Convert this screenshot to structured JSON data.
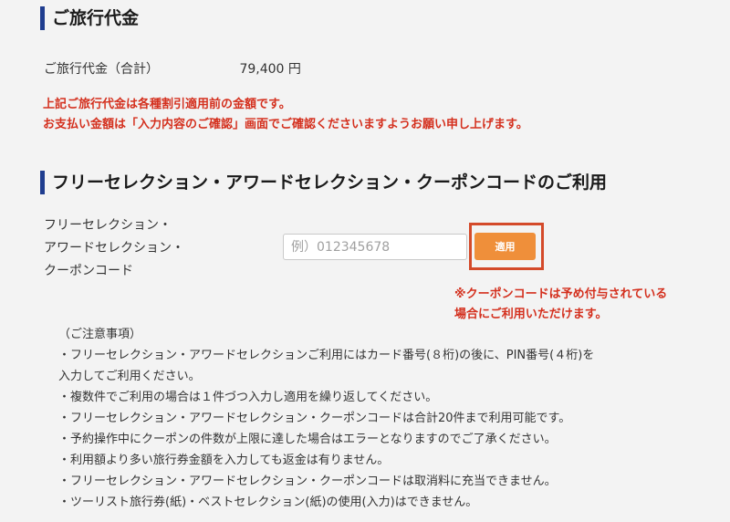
{
  "fare_section": {
    "heading": "ご旅行代金",
    "label": "ご旅行代金（合計）",
    "value": "79,400 円",
    "warning_1": "上記ご旅行代金は各種割引適用前の金額です。",
    "warning_2": "お支払い金額は「入力内容のご確認」画面でご確認くださいますようお願い申し上げます。"
  },
  "coupon_section": {
    "heading": "フリーセレクション・アワードセレクション・クーポンコードのご利用",
    "label_lines": [
      "フリーセレクション・",
      "アワードセレクション・",
      "クーポンコード"
    ],
    "input_placeholder": "例）012345678",
    "input_value": "",
    "apply_label": "適用",
    "note_lines": [
      "※クーポンコードは予め付与されている",
      "場合にご利用いただけます。"
    ]
  },
  "notes": {
    "title": "（ご注意事項）",
    "items": [
      "・フリーセレクション・アワードセレクションご利用にはカード番号(８桁)の後に、PIN番号(４桁)を",
      "入力してご利用ください。",
      "・複数件でご利用の場合は１件づつ入力し適用を繰り返してください。",
      "・フリーセレクション・アワードセレクション・クーポンコードは合計20件まで利用可能です。",
      "・予約操作中にクーポンの件数が上限に達した場合はエラーとなりますのでご了承ください。",
      "・利用額より多い旅行券金額を入力しても返金は有りません。",
      "・フリーセレクション・アワードセレクション・クーポンコードは取消料に充当できません。",
      "・ツーリスト旅行券(紙)・ベストセレクション(紙)の使用(入力)はできません。"
    ]
  }
}
